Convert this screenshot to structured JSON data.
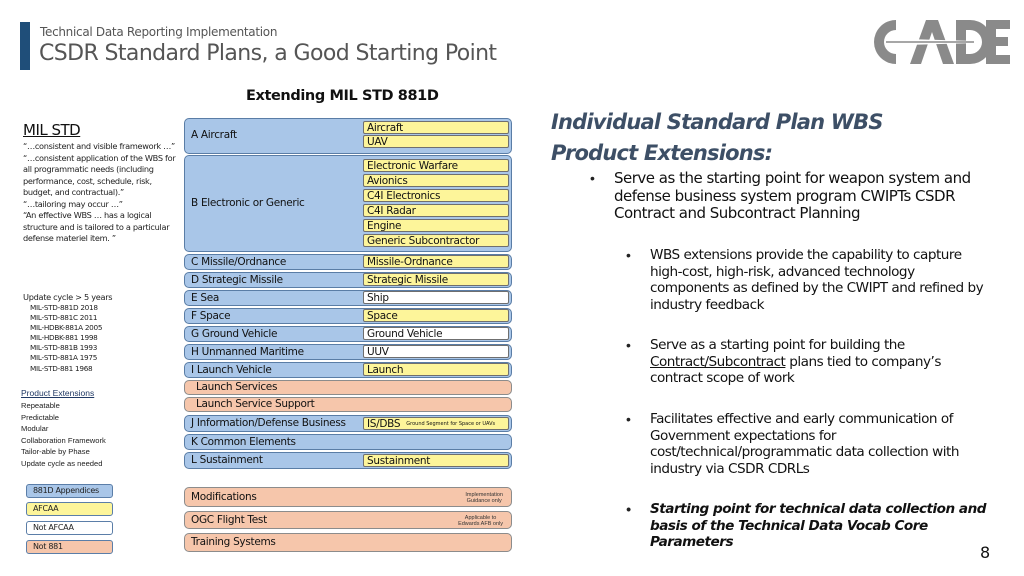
{
  "header": {
    "subtitle": "Technical Data Reporting Implementation",
    "title": "CSDR Standard Plans, a Good Starting Point",
    "logo_text": "CADE",
    "accent_color": "#1f4e79"
  },
  "center_heading": "Extending MIL STD 881D",
  "left_column": {
    "milstd_title": "MIL STD",
    "quotes": [
      "“…consistent and visible framework …”",
      "“…consistent application of the WBS for all programmatic needs (including performance, cost, schedule, risk, budget, and contractual).”",
      "“…tailoring may occur …”",
      "“An effective WBS … has a logical structure and is tailored to a particular defense materiel item. ”"
    ],
    "update_title": "Update cycle > 5 years",
    "versions": [
      "MIL-STD-881D 2018",
      "MIL-STD-881C 2011",
      "MIL-HDBK-881A 2005",
      "MIL-HDBK-881 1998",
      "MIL-STD-881B 1993",
      "MIL-STD-881A 1975",
      "MIL-STD-881 1968"
    ],
    "product_extensions_title": "Product Extensions",
    "product_extensions": [
      "Repeatable",
      "Predictable",
      "Modular",
      "Collaboration Framework",
      "Tailor-able by Phase",
      "Update cycle as needed"
    ]
  },
  "legend": [
    {
      "label": "881D Appendices",
      "color": "#a9c6e8"
    },
    {
      "label": "AFCAA",
      "color": "#fdf59a"
    },
    {
      "label": "Not AFCAA",
      "color": "#ffffff"
    },
    {
      "label": "Not 881",
      "color": "#f6c6ab"
    }
  ],
  "wbs": {
    "a": {
      "label": "A Aircraft",
      "ext": [
        "Aircraft",
        "UAV"
      ]
    },
    "b": {
      "label": "B Electronic or Generic",
      "ext": [
        "Electronic Warfare",
        "Avionics",
        "C4I Electronics",
        "C4I Radar",
        "Engine",
        "Generic Subcontractor"
      ]
    },
    "c": {
      "label": "C Missile/Ordnance",
      "ext": "Missile-Ordnance"
    },
    "d": {
      "label": "D Strategic Missile",
      "ext": "Strategic Missile"
    },
    "e": {
      "label": "E Sea",
      "ext": "Ship"
    },
    "f": {
      "label": "F Space",
      "ext": "Space"
    },
    "g": {
      "label": "G Ground Vehicle",
      "ext": "Ground Vehicle"
    },
    "h": {
      "label": "H Unmanned Maritime",
      "ext": "UUV"
    },
    "i": {
      "label": "I Launch Vehicle",
      "ext": "Launch"
    },
    "launch_services": {
      "label": "Launch Services"
    },
    "launch_service_support": {
      "label": "Launch Service Support"
    },
    "j": {
      "label": "J Information/Defense Business",
      "ext": "IS/DBS",
      "ext_note": "Ground Segment for Space or UAVs"
    },
    "k": {
      "label": "K Common Elements"
    },
    "l": {
      "label": "L Sustainment",
      "ext": "Sustainment"
    },
    "modifications": {
      "label": "Modifications",
      "note_line1": "Implementation",
      "note_line2": "Guidance only"
    },
    "ogc": {
      "label": "OGC Flight Test",
      "note_line1": "Applicable to",
      "note_line2": "Edwards AFB only"
    },
    "training": {
      "label": "Training Systems"
    }
  },
  "right_column": {
    "heading": "Individual Standard Plan WBS Product Extensions:",
    "bullet_glyph": "•",
    "bullet1": "Serve as the starting point for weapon system and defense business system program CWIPTs CSDR Contract and Subcontract Planning",
    "bullet2": "WBS extensions provide the capability to capture high-cost, high-risk, advanced technology components as defined by the CWIPT and refined by industry feedback",
    "bullet3_pre": "Serve as a starting point for building the ",
    "bullet3_link": "Contract/Subcontract",
    "bullet3_post": " plans tied to company’s contract scope of work",
    "bullet4": "Facilitates effective and early communication of Government expectations for cost/technical/programmatic data collection with industry via CSDR CDRLs",
    "bullet5": "Starting point for technical data collection and basis of the Technical Data Vocab Core Parameters"
  },
  "page_number": "8"
}
